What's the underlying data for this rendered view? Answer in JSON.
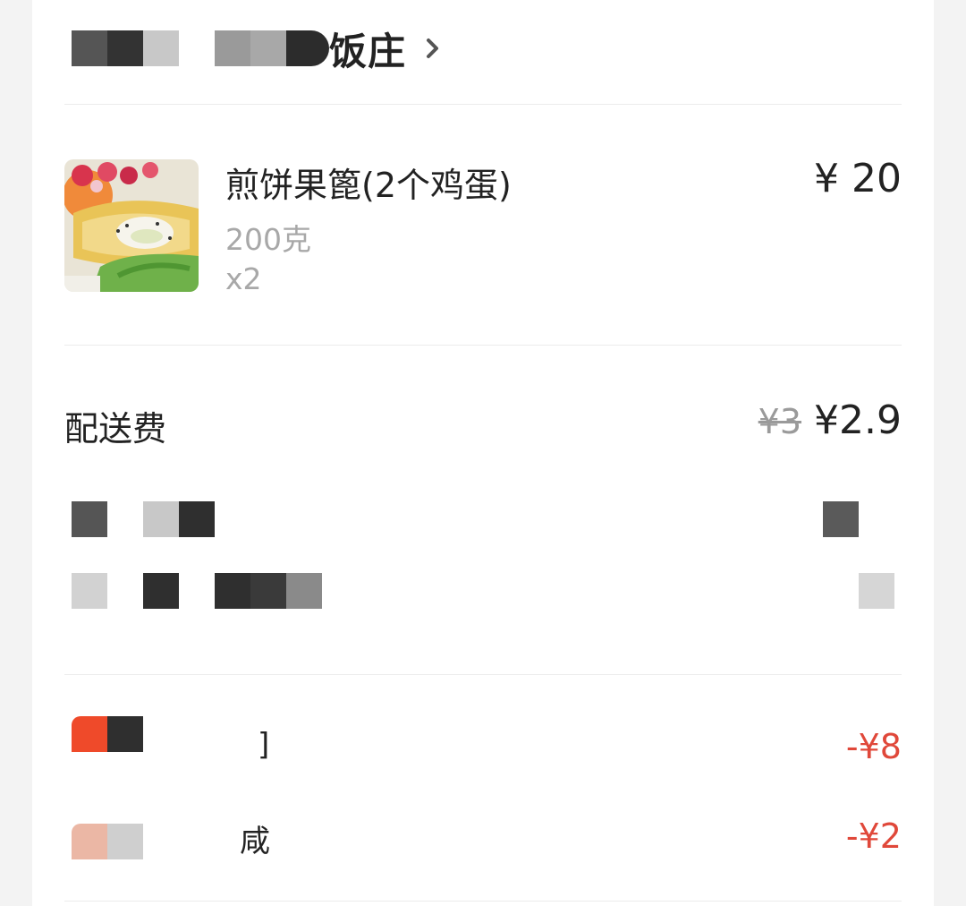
{
  "store": {
    "name_visible": "饭庄",
    "chevron_icon": "chevron-right-icon"
  },
  "item": {
    "name": "煎饼果篦(2个鸡蛋)",
    "spec": "200克",
    "quantity": "x2",
    "price": "¥ 20",
    "image_icon": "food-photo"
  },
  "delivery": {
    "label": "配送费",
    "original_price": "¥3",
    "price": "¥2.9"
  },
  "discounts": [
    {
      "text_fragment": "]",
      "amount": "-¥8"
    },
    {
      "text_fragment": "咸",
      "amount": "-¥2"
    }
  ],
  "colors": {
    "discount_red": "#e0483a",
    "tag_red": "#ef4a2a"
  }
}
